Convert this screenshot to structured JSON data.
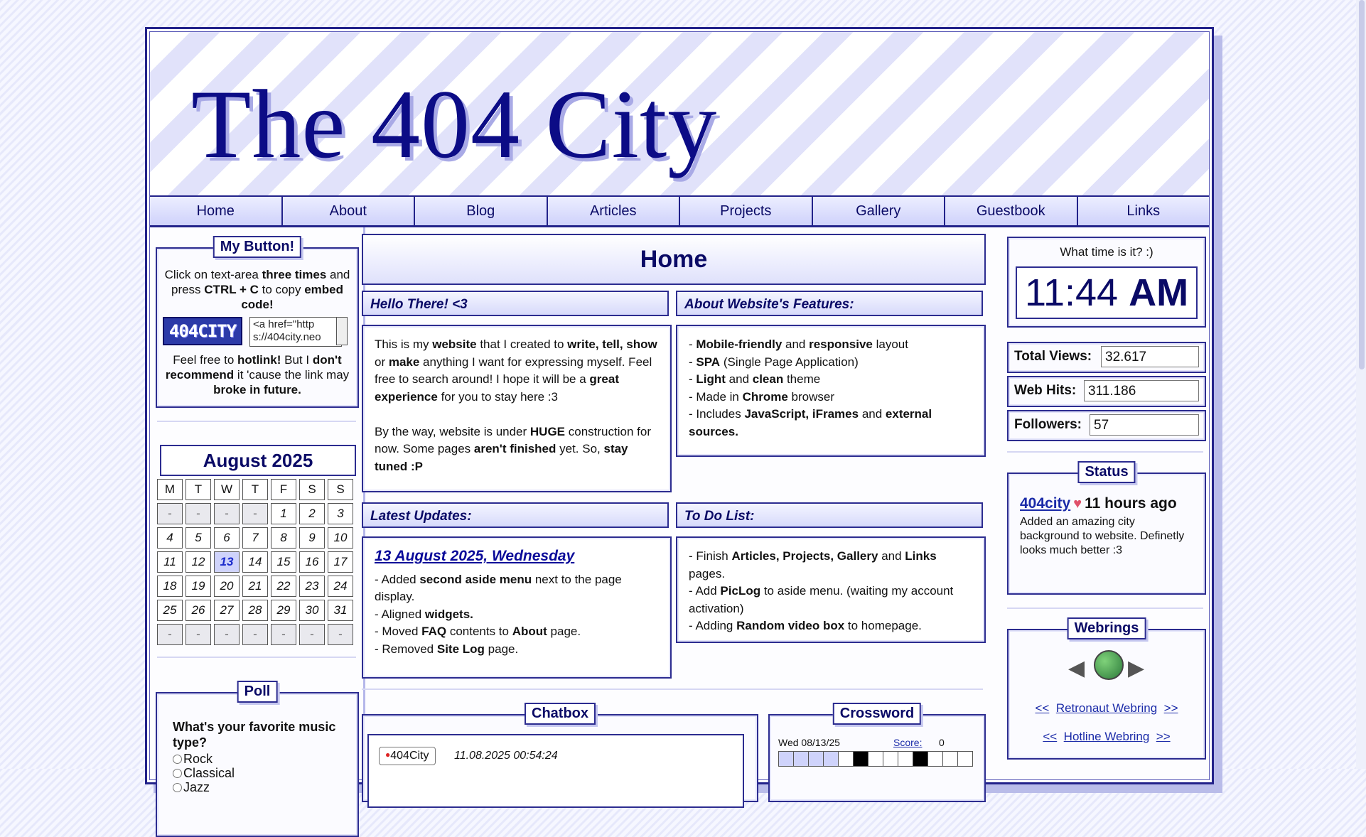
{
  "site": {
    "title": "The 404 City"
  },
  "nav": [
    "Home",
    "About",
    "Blog",
    "Articles",
    "Projects",
    "Gallery",
    "Guestbook",
    "Links"
  ],
  "my_button": {
    "title": "My Button!",
    "instructions_html": "Click on text-area <b>three times</b> and press <b>CTRL + C</b> to copy <b>embed code!</b>",
    "badge_text": "404CITY",
    "code": "<a href=\"http\ns://404city.neo",
    "note_html": "Feel free to <b>hotlink!</b> But I <b>don't recommend</b> it 'cause the link may <b>broke in future.</b>"
  },
  "calendar": {
    "title": "August 2025",
    "weekdays": [
      "M",
      "T",
      "W",
      "T",
      "F",
      "S",
      "S"
    ],
    "days": [
      "-",
      "-",
      "-",
      "-",
      "1",
      "2",
      "3",
      "4",
      "5",
      "6",
      "7",
      "8",
      "9",
      "10",
      "11",
      "12",
      "13",
      "14",
      "15",
      "16",
      "17",
      "18",
      "19",
      "20",
      "21",
      "22",
      "23",
      "24",
      "25",
      "26",
      "27",
      "28",
      "29",
      "30",
      "31",
      "-",
      "-",
      "-",
      "-",
      "-",
      "-",
      "-"
    ],
    "today": "13"
  },
  "poll": {
    "title": "Poll",
    "question": "What's your favorite music type?",
    "options": [
      "Rock",
      "Classical",
      "Jazz"
    ]
  },
  "home": {
    "title": "Home"
  },
  "hello": {
    "title": "Hello There! <3",
    "body_html": "This is my <b>website</b> that I created to <b>write, tell, show</b> or <b>make</b> anything I want for expressing myself. Feel free to search around! I hope it will be a <b>great experience</b> for you to stay here :3<br><br>By the way, website is under <b>HUGE</b> construction for now. Some pages <b>aren't finished</b> yet. So, <b>stay tuned :P</b>"
  },
  "features": {
    "title": "About Website's Features:",
    "body_html": "- <b>Mobile-friendly</b> and <b>responsive</b> layout<br>- <b>SPA</b> (Single Page Application)<br>- <b>Light</b> and <b>clean</b> theme<br>- Made in <b>Chrome</b> browser<br>- Includes <b>JavaScript, iFrames</b> and <b>external sources.</b>"
  },
  "updates": {
    "title": "Latest Updates:",
    "date": "13 August 2025, Wednesday",
    "body_html": "- Added <b>second aside menu</b> next to the page display.<br>- Aligned <b>widgets.</b><br>- Moved <b>FAQ</b> contents to <b>About</b> page.<br>- Removed <b>Site Log</b> page."
  },
  "todo": {
    "title": "To Do List:",
    "body_html": "- Finish <b>Articles, Projects, Gallery</b> and <b>Links</b> pages.<br>- Add <b>PicLog</b> to aside menu. (waiting my account activation)<br>- Adding <b>Random video box</b> to homepage."
  },
  "chatbox": {
    "title": "Chatbox",
    "user": "404City",
    "time": "11.08.2025 00:54:24"
  },
  "crossword": {
    "title": "Crossword",
    "date": "Wed 08/13/25",
    "score_label": "Score:",
    "score": "0"
  },
  "clock": {
    "label": "What time is it? :)",
    "time": "11:44",
    "period": "AM"
  },
  "stats": [
    {
      "label": "Total Views:",
      "value": "32.617"
    },
    {
      "label": "Web Hits:",
      "value": "311.186"
    },
    {
      "label": "Followers:",
      "value": "57"
    }
  ],
  "status": {
    "title": "Status",
    "user": "404city",
    "ago": "11 hours ago",
    "message": "Added an amazing city background to website. Definetly looks much better :3"
  },
  "webrings": {
    "title": "Webrings",
    "rings": [
      "Retronaut Webring",
      "Hotline Webring"
    ],
    "prev": "<<",
    "next": ">>"
  },
  "colors": {
    "accent": "#0c0c86",
    "border": "#2c2c90",
    "panel_bg": "#dfe1fc"
  }
}
